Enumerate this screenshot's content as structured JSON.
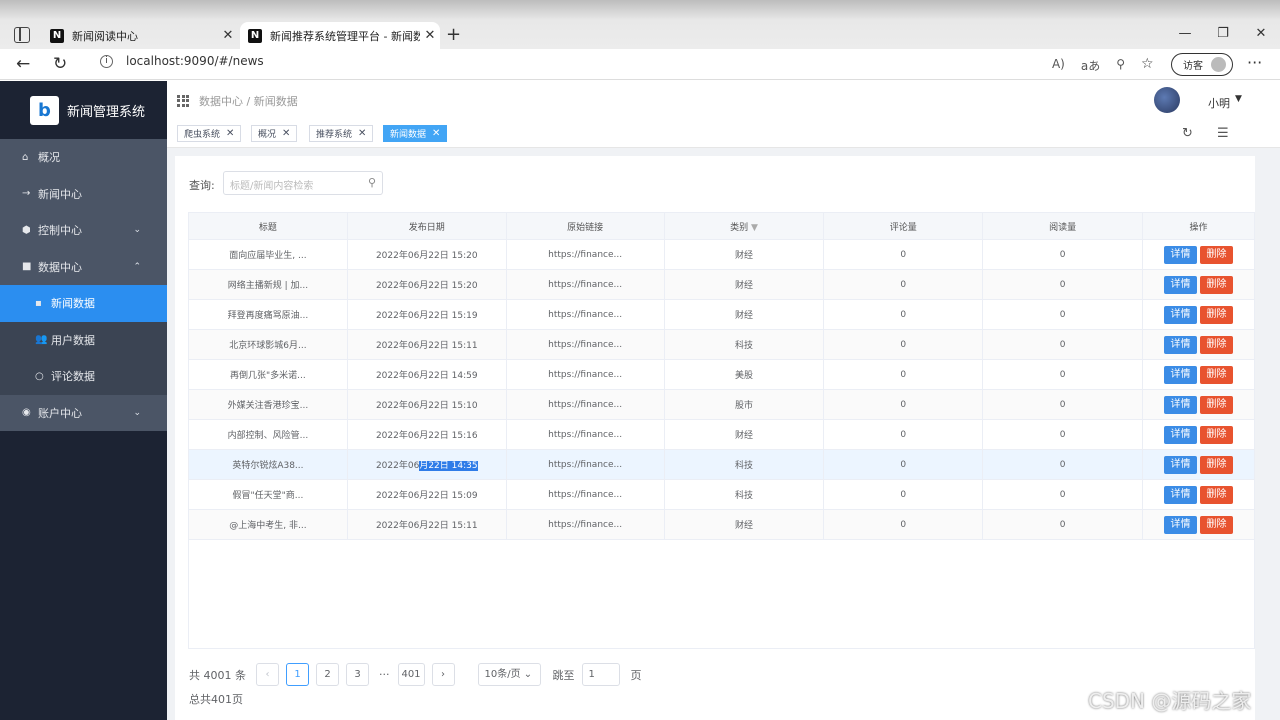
{
  "browser": {
    "tabs": [
      {
        "title": "新闻阅读中心",
        "favicon": "N"
      },
      {
        "title": "新闻推荐系统管理平台 - 新闻数",
        "favicon": "N"
      }
    ],
    "url": "localhost:9090/#/news",
    "guest_label": "访客"
  },
  "app": {
    "title": "新闻管理系统",
    "logo": "b"
  },
  "sidebar": {
    "items": [
      {
        "label": "概况",
        "icon": "home-icon"
      },
      {
        "label": "新闻中心",
        "icon": "arrow-right-icon"
      },
      {
        "label": "控制中心",
        "icon": "gear-icon"
      },
      {
        "label": "数据中心",
        "icon": "data-icon"
      },
      {
        "label": "新闻数据",
        "icon": "doc-icon"
      },
      {
        "label": "用户数据",
        "icon": "users-icon"
      },
      {
        "label": "评论数据",
        "icon": "comment-icon"
      },
      {
        "label": "账户中心",
        "icon": "account-icon"
      }
    ]
  },
  "header": {
    "breadcrumb": "数据中心 / 新闻数据",
    "username": "小明"
  },
  "tags": [
    "爬虫系统",
    "概况",
    "推荐系统",
    "新闻数据"
  ],
  "search": {
    "label": "查询:",
    "placeholder": "标题/新闻内容检索"
  },
  "table": {
    "columns": [
      "标题",
      "发布日期",
      "原始链接",
      "类别",
      "评论量",
      "阅读量",
      "操作"
    ],
    "rows": [
      {
        "title": "面向应届毕业生, ...",
        "date": "2022年06月22日 15:20",
        "link": "https://finance...",
        "category": "财经",
        "comments": "0",
        "reads": "0"
      },
      {
        "title": "网络主播新规 | 加...",
        "date": "2022年06月22日 15:20",
        "link": "https://finance...",
        "category": "财经",
        "comments": "0",
        "reads": "0"
      },
      {
        "title": "拜登再度痛骂原油...",
        "date": "2022年06月22日 15:19",
        "link": "https://finance...",
        "category": "财经",
        "comments": "0",
        "reads": "0"
      },
      {
        "title": "北京环球影城6月...",
        "date": "2022年06月22日 15:11",
        "link": "https://finance...",
        "category": "科技",
        "comments": "0",
        "reads": "0"
      },
      {
        "title": "再倒几张\"多米诺...",
        "date": "2022年06月22日 14:59",
        "link": "https://finance...",
        "category": "美股",
        "comments": "0",
        "reads": "0"
      },
      {
        "title": "外媒关注香港珍宝...",
        "date": "2022年06月22日 15:10",
        "link": "https://finance...",
        "category": "股市",
        "comments": "0",
        "reads": "0"
      },
      {
        "title": "内部控制、风险管...",
        "date": "2022年06月22日 15:16",
        "link": "https://finance...",
        "category": "财经",
        "comments": "0",
        "reads": "0"
      },
      {
        "title": "英特尔锐炫A38...",
        "date_prefix": "2022年06",
        "date_selected": "月22日 14:35",
        "link": "https://finance...",
        "category": "科技",
        "comments": "0",
        "reads": "0"
      },
      {
        "title": "假冒\"任天堂\"商...",
        "date": "2022年06月22日 15:09",
        "link": "https://finance...",
        "category": "科技",
        "comments": "0",
        "reads": "0"
      },
      {
        "title": "@上海中考生, 非...",
        "date": "2022年06月22日 15:11",
        "link": "https://finance...",
        "category": "财经",
        "comments": "0",
        "reads": "0"
      }
    ],
    "detail_label": "详情",
    "delete_label": "删除"
  },
  "pagination": {
    "total": "共 4001 条",
    "pages": [
      "1",
      "2",
      "3",
      "···",
      "401"
    ],
    "page_size": "10条/页",
    "jump_label": "跳至",
    "jump_value": "1",
    "page_unit": "页",
    "pages_total": "总共401页"
  },
  "watermark": "CSDN @源码之家"
}
